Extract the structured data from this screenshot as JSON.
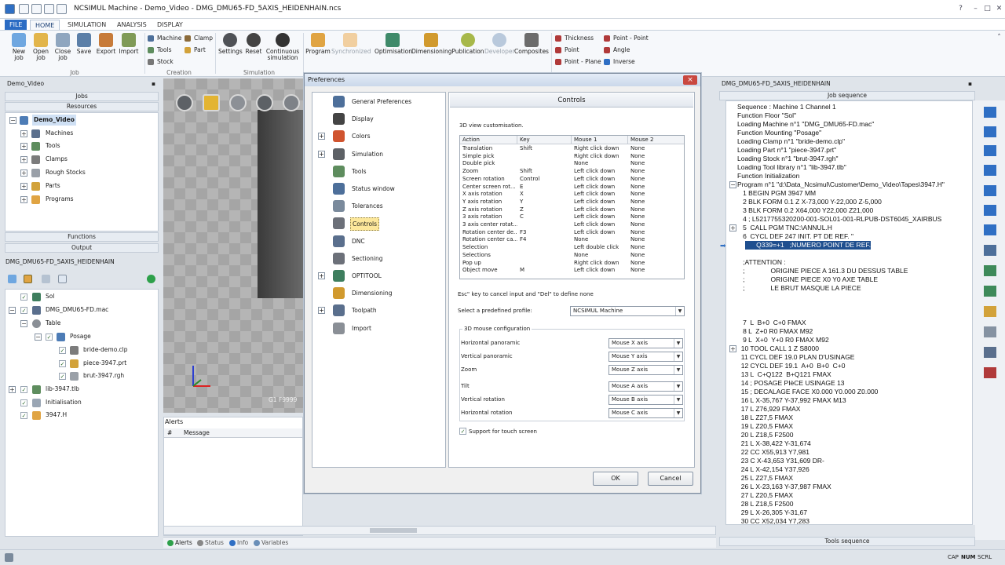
{
  "window": {
    "title": "NCSIMUL Machine - Demo_Video - DMG_DMU65-FD_5AXIS_HEIDENHAIN.ncs"
  },
  "menu_tabs": [
    "FILE",
    "HOME",
    "SIMULATION",
    "ANALYSIS",
    "DISPLAY"
  ],
  "ribbon": {
    "job": [
      "New job",
      "Open job",
      "Close job",
      "Save",
      "Export",
      "Import"
    ],
    "creation": [
      "Machine",
      "Clamp",
      "Tools",
      "Part",
      "Stock"
    ],
    "simulation": [
      "Settings",
      "Reset",
      "Continuous simulation"
    ],
    "program": [
      "Program",
      "Synchronized"
    ],
    "tools_group": [
      "Optimisation",
      "Dimensioning",
      "Publication",
      "Developer",
      "Composites"
    ],
    "measure": [
      "Thickness",
      "Point - Point",
      "Point",
      "Angle",
      "Point - Plane",
      "Inverse"
    ],
    "groups": {
      "job": "Job",
      "creation": "Creation",
      "simulation": "Simulation"
    }
  },
  "left": {
    "demo_header": "Demo_Video",
    "jobs": "Jobs",
    "resources": "Resources",
    "tree_root": "Demo_Video",
    "tree_items": [
      "Machines",
      "Tools",
      "Clamps",
      "Rough Stocks",
      "Parts",
      "Programs"
    ],
    "functions": "Functions",
    "output": "Output",
    "machine_label": "DMG_DMU65-FD_5AXIS_HEIDENHAIN",
    "output_tree": [
      "Sol",
      "DMG_DMU65-FD.mac",
      "Table",
      "Posage",
      "bride-demo.clp",
      "piece-3947.prt",
      "brut-3947.rgh",
      "lib-3947.tlb",
      "Initialisation",
      "3947.H"
    ]
  },
  "viewport": {
    "status": "G1   F9999"
  },
  "alerts": {
    "title": "Alerts",
    "col_hash": "#",
    "col_message": "Message"
  },
  "bottom_tabs": [
    "Alerts",
    "Status",
    "Info",
    "Variables"
  ],
  "statusbar": {
    "cap": "CAP",
    "num": "NUM",
    "scrl": "SCRL"
  },
  "right": {
    "header": "DMG_DMU65-FD_5AXIS_HEIDENHAIN",
    "job_sequence": "Job sequence",
    "tools_sequence": "Tools sequence",
    "lines": [
      "Sequence : Machine 1 Channel 1",
      "Function Floor \"Sol\"",
      "Loading Machine n°1 \"DMG_DMU65-FD.mac\"",
      "Function Mounting \"Posage\"",
      "Loading Clamp n°1 \"bride-demo.clp\"",
      "Loading Part n°1 \"piece-3947.prt\"",
      "Loading Stock n°1 \"brut-3947.rgh\"",
      "Loading Tool library n°1 \"lib-3947.tlb\"",
      "Function Initialization",
      "Program n°1 \"d:\\Data_Ncsimul\\Customer\\Demo_Video\\Tapes\\3947.H\"",
      "   1 BEGIN PGM 3947 MM",
      "   2 BLK FORM 0.1 Z X-73,000 Y-22,000 Z-5,000",
      "   3 BLK FORM 0.2 X64,000 Y22,000 Z21,000",
      "   4 ; L5217755320200-001-SOL01-001-RLPUB-DST6045_XAIRBUS",
      "   5  CALL PGM TNC:\\ANNUL.H",
      "   6  CYCL DEF 247 INIT. PT DE REF. \"",
      "      Q339=+1   ;NUMERO POINT DE REF.",
      "",
      "   ;ATTENTION :",
      "   ;              ORIGINE PIECE A 161.3 DU DESSUS TABLE",
      "   ;              ORIGINE PIECE X0 Y0 AXE TABLE",
      "   ;              LE BRUT MASQUE LA PIECE",
      "",
      "",
      "",
      "   7  L  B+0  C+0 FMAX",
      "   8 L  Z+0 R0 FMAX M92",
      "   9 L  X+0  Y+0 R0 FMAX M92",
      "  10 TOOL CALL 1 Z S8000",
      "  11 CYCL DEF 19.0 PLAN D'USINAGE",
      "  12 CYCL DEF 19.1  A+0  B+0  C+0",
      "  13 L  C+Q122  B+Q121 FMAX",
      "  14 ; POSAGE PIèCE USINAGE 13",
      "  15 ; DECALAGE FACE X0.000 Y0.000 Z0.000",
      "  16 L X-35,767 Y-37,992 FMAX M13",
      "  17 L Z76,929 FMAX",
      "  18 L Z27,5 FMAX",
      "  19 L Z20,5 FMAX",
      "  20 L Z18,5 F2500",
      "  21 L X-38,422 Y-31,674",
      "  22 CC X55,913 Y7,981",
      "  23 C X-43,653 Y31,609 DR-",
      "  24 L X-42,154 Y37,926",
      "  25 L Z27,5 FMAX",
      "  26 L X-23,163 Y-37,987 FMAX",
      "  27 L Z20,5 FMAX",
      "  28 L Z18,5 F2500",
      "  29 L X-26,305 Y-31,67",
      "  30 CC X52,034 Y7,283"
    ]
  },
  "dialog": {
    "title": "Preferences",
    "close": "×",
    "nav": [
      "General Preferences",
      "Display",
      "Colors",
      "Simulation",
      "Tools",
      "Status window",
      "Tolerances",
      "Controls",
      "DNC",
      "Sectioning",
      "OPTITOOL",
      "Dimensioning",
      "Toolpath",
      "Import"
    ],
    "panel_title": "Controls",
    "view_label": "3D view customisation.",
    "table_headers": [
      "Action",
      "Key",
      "Mouse 1",
      "Mouse 2"
    ],
    "table_rows": [
      [
        "Translation",
        "Shift",
        "Right click down",
        "None"
      ],
      [
        "Simple pick",
        "",
        "Right click down",
        "None"
      ],
      [
        "Double pick",
        "",
        "None",
        "None"
      ],
      [
        "Zoom",
        "Shift",
        "Left click down",
        "None"
      ],
      [
        "Screen rotation",
        "Control",
        "Left click down",
        "None"
      ],
      [
        "Center screen rot...",
        "E",
        "Left click down",
        "None"
      ],
      [
        "X axis rotation",
        "X",
        "Left click down",
        "None"
      ],
      [
        "Y axis rotation",
        "Y",
        "Left click down",
        "None"
      ],
      [
        "Z axis rotation",
        "Z",
        "Left click down",
        "None"
      ],
      [
        "3 axis rotation",
        "C",
        "Left click down",
        "None"
      ],
      [
        "3 axis center rotat...",
        "",
        "Left click down",
        "None"
      ],
      [
        "Rotation center de...",
        "F3",
        "Left click down",
        "None"
      ],
      [
        "Rotation center ca...",
        "F4",
        "None",
        "None"
      ],
      [
        "Selection",
        "",
        "Left double click",
        "None"
      ],
      [
        "Selections",
        "",
        "None",
        "None"
      ],
      [
        "Pop up",
        "",
        "Right click down",
        "None"
      ],
      [
        "Object move",
        "M",
        "Left click down",
        "None"
      ]
    ],
    "esc_hint": "Esc\" key to cancel input and \"Del\" to define none",
    "profile_label": "Select a predefined profile:",
    "profile_value": "NCSIMUL Machine",
    "mouse3d_label": "3D mouse configuration",
    "mouse3d": [
      {
        "label": "Horizontal panoramic",
        "value": "Mouse X axis"
      },
      {
        "label": "Vertical panoramic",
        "value": "Mouse Y axis"
      },
      {
        "label": "Zoom",
        "value": "Mouse Z axis"
      },
      {
        "label": "Tilt",
        "value": "Mouse A axis"
      },
      {
        "label": "Vertical rotation",
        "value": "Mouse B axis"
      },
      {
        "label": "Horizontal rotation",
        "value": "Mouse C axis"
      }
    ],
    "touch_label": "Support for touch screen",
    "ok": "OK",
    "cancel": "Cancel"
  }
}
